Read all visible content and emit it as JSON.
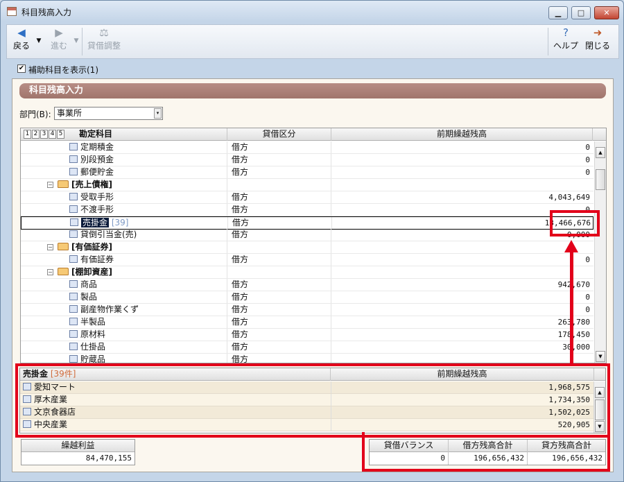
{
  "window": {
    "title": "科目残高入力",
    "minimize": "▁",
    "maximize": "□",
    "close": "✕"
  },
  "toolbar": {
    "back": "戻る",
    "back_icon": "◀",
    "dropdown": "▼",
    "forward": "進む",
    "forward_icon": "▶",
    "balance": "貸借調整",
    "balance_icon": "⚖",
    "help": "ヘルプ",
    "help_icon": "?",
    "close": "閉じる",
    "close_icon": "➜"
  },
  "options": {
    "show_sub_accounts": "補助科目を表示(1)",
    "checked": "✔"
  },
  "banner": {
    "title": "科目残高入力"
  },
  "department": {
    "label": "部門(B):",
    "value": "事業所",
    "arrow": "▾"
  },
  "grid": {
    "levels": [
      "1",
      "2",
      "3",
      "4",
      "5"
    ],
    "columns": {
      "account": "勘定科目",
      "dc": "貸借区分",
      "balance": "前期繰越残高"
    },
    "rows": [
      {
        "type": "item",
        "name": "定期積金",
        "dc": "借方",
        "balance": "0"
      },
      {
        "type": "item",
        "name": "別段預金",
        "dc": "借方",
        "balance": "0"
      },
      {
        "type": "item",
        "name": "郵便貯金",
        "dc": "借方",
        "balance": "0"
      },
      {
        "type": "group",
        "toggle": "−",
        "name": "[売上債権]",
        "dc": "",
        "balance": ""
      },
      {
        "type": "item",
        "name": "受取手形",
        "dc": "借方",
        "balance": "4,043,649"
      },
      {
        "type": "item",
        "name": "不渡手形",
        "dc": "借方",
        "balance": "0"
      },
      {
        "type": "selected",
        "name": "売掛金",
        "count": "[39]",
        "dc": "借方",
        "balance": "13,466,676"
      },
      {
        "type": "item",
        "name": "貸倒引当金(売)",
        "dc": "借方",
        "balance": "0,000"
      },
      {
        "type": "group",
        "toggle": "−",
        "name": "[有価証券]",
        "dc": "",
        "balance": ""
      },
      {
        "type": "item",
        "name": "有価証券",
        "dc": "借方",
        "balance": "0"
      },
      {
        "type": "group",
        "toggle": "−",
        "name": "[棚卸資産]",
        "dc": "",
        "balance": ""
      },
      {
        "type": "item",
        "name": "商品",
        "dc": "借方",
        "balance": "942,670"
      },
      {
        "type": "item",
        "name": "製品",
        "dc": "借方",
        "balance": "0"
      },
      {
        "type": "item",
        "name": "副産物作業くず",
        "dc": "借方",
        "balance": "0"
      },
      {
        "type": "item",
        "name": "半製品",
        "dc": "借方",
        "balance": "263,780"
      },
      {
        "type": "item",
        "name": "原材料",
        "dc": "借方",
        "balance": "178,450"
      },
      {
        "type": "item",
        "name": "仕掛品",
        "dc": "借方",
        "balance": "30,000"
      },
      {
        "type": "item",
        "name": "貯蔵品",
        "dc": "借方",
        "balance": ""
      }
    ]
  },
  "subgrid": {
    "account": "売掛金",
    "count": "[39件]",
    "balance_header": "前期繰越残高",
    "rows": [
      {
        "name": "愛知マート",
        "balance": "1,968,575"
      },
      {
        "name": "厚木産業",
        "balance": "1,734,350"
      },
      {
        "name": "文京食器店",
        "balance": "1,502,025"
      },
      {
        "name": "中央産業",
        "balance": "520,905"
      }
    ]
  },
  "summary": {
    "retained_label": "繰越利益",
    "retained_value": "84,470,155",
    "balance_label": "貸借バランス",
    "balance_value": "0",
    "debit_label": "借方残高合計",
    "debit_value": "196,656,432",
    "credit_label": "貸方残高合計",
    "credit_value": "196,656,432"
  },
  "scroll": {
    "up": "▲",
    "down": "▼"
  },
  "colors": {
    "highlight": "#e2001a",
    "banner": "#a67c73",
    "selection": "#0a1a3a"
  }
}
